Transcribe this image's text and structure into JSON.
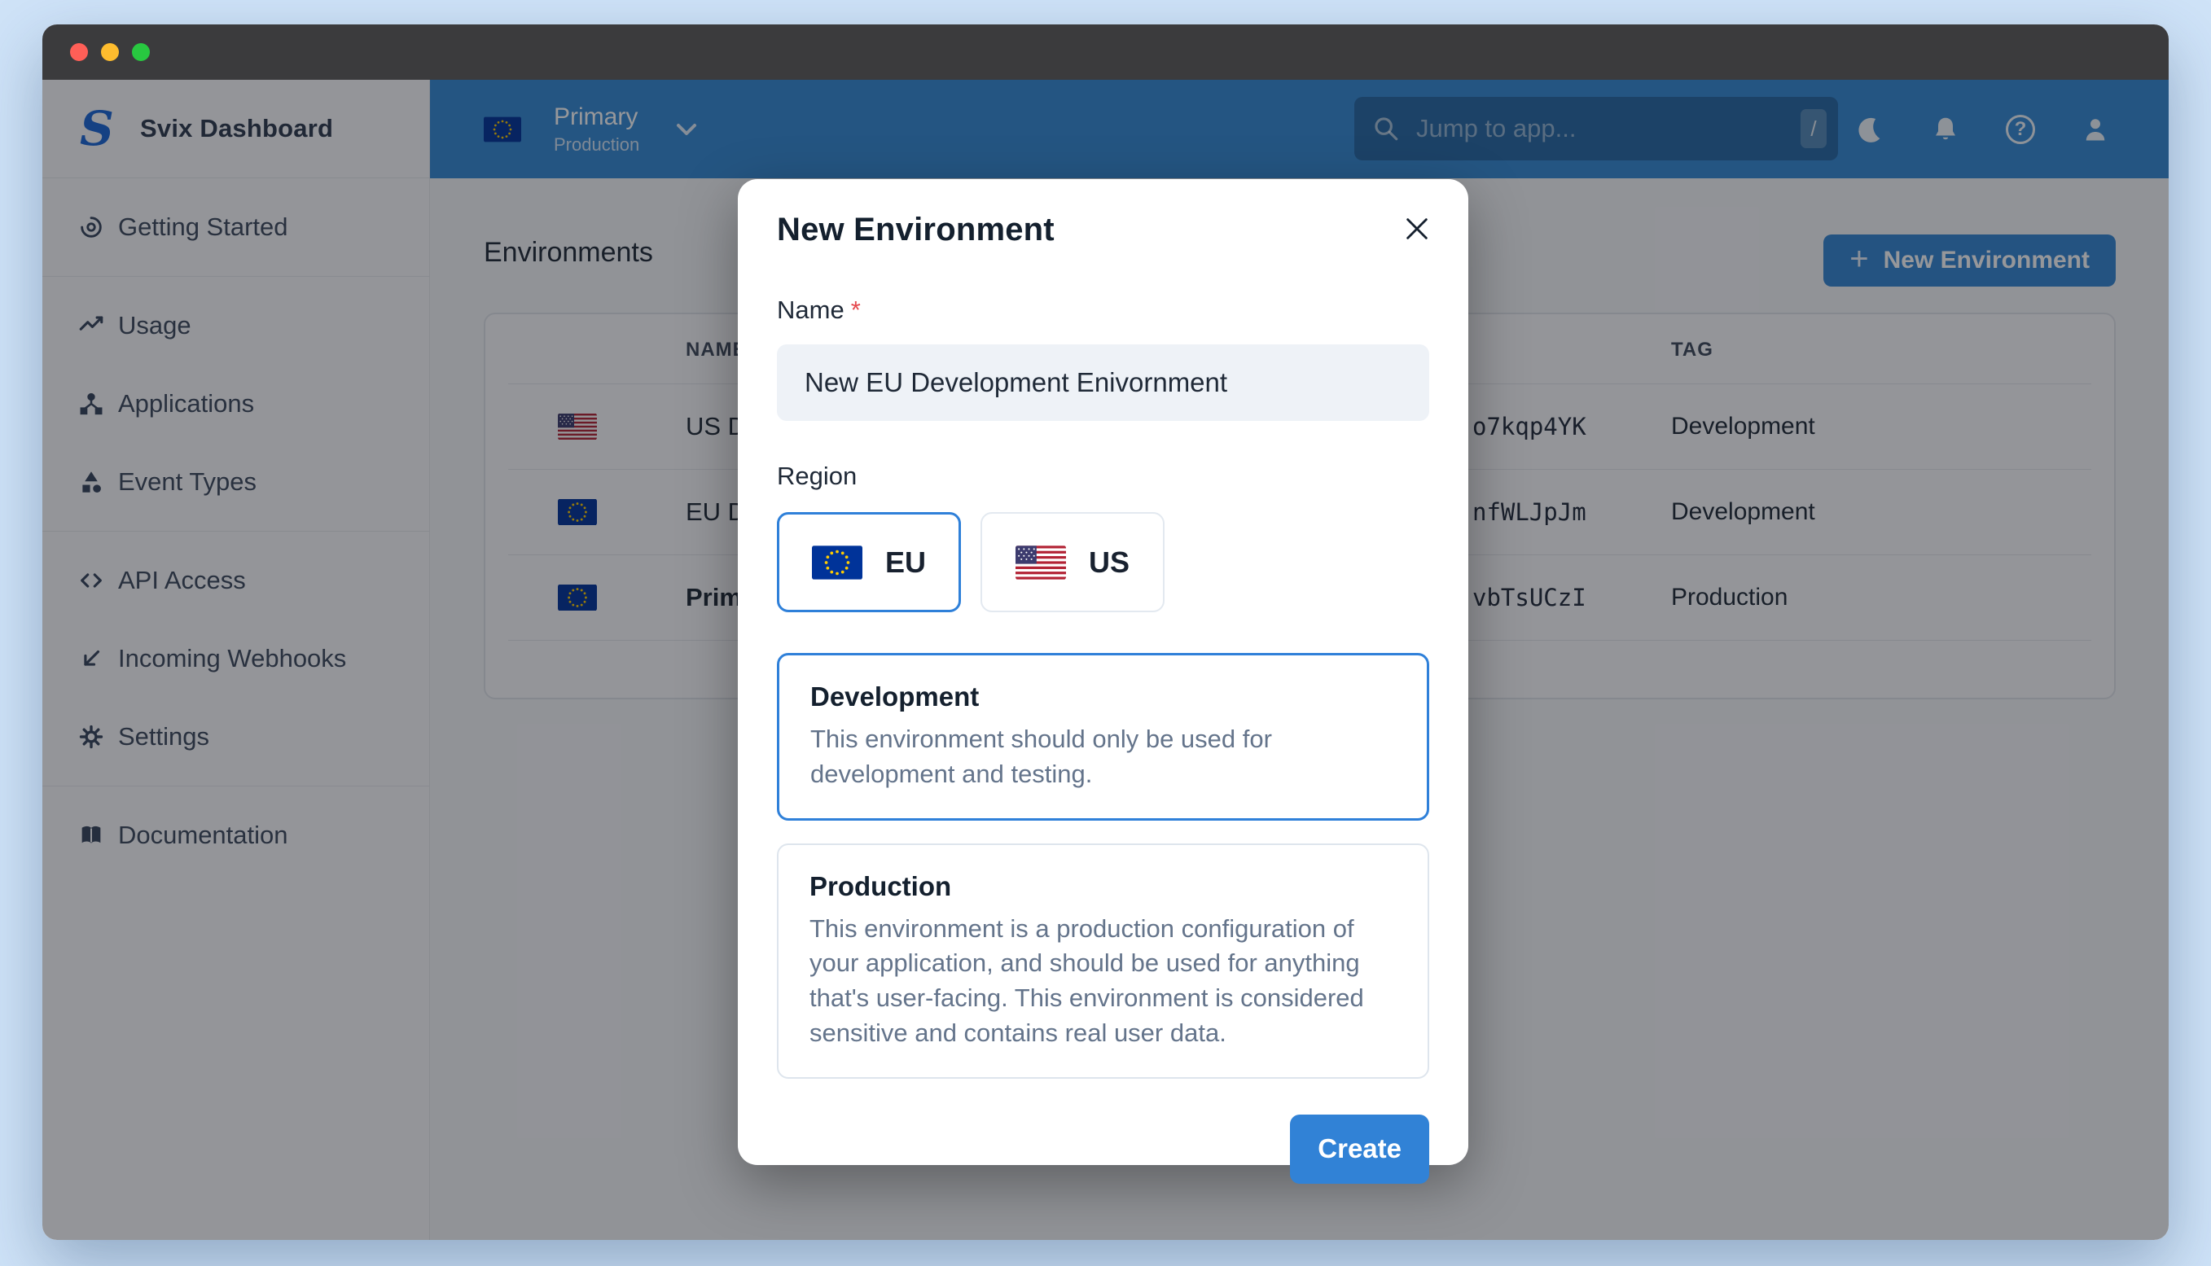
{
  "colors": {
    "brand_blue": "#3489D5",
    "button_blue": "#3182D6",
    "selected_border": "#2F80D9",
    "page_bg": "#CFE3F8",
    "titlebar_bg": "#3B3B3D",
    "overlay": "rgba(16,19,26,0.44)",
    "required_red": "#E5484D",
    "traffic_red": "#FF5F57",
    "traffic_yellow": "#FEBC2E",
    "traffic_green": "#28C840",
    "eu_flag_blue": "#003399",
    "eu_flag_gold": "#FFCC00",
    "us_flag_red": "#B22234",
    "us_flag_navy": "#3C3B6E"
  },
  "sidebar": {
    "brand": "Svix Dashboard",
    "logo_letter": "S",
    "sections": [
      {
        "items": [
          {
            "label": "Getting Started",
            "icon": "target-icon"
          }
        ]
      },
      {
        "items": [
          {
            "label": "Usage",
            "icon": "trend-line-icon"
          },
          {
            "label": "Applications",
            "icon": "nodes-icon"
          },
          {
            "label": "Event Types",
            "icon": "shapes-icon"
          }
        ]
      },
      {
        "items": [
          {
            "label": "API Access",
            "icon": "code-brackets-icon"
          },
          {
            "label": "Incoming Webhooks",
            "icon": "arrow-down-left-icon"
          },
          {
            "label": "Settings",
            "icon": "gear-icon"
          }
        ]
      },
      {
        "items": [
          {
            "label": "Documentation",
            "icon": "book-icon"
          }
        ]
      }
    ]
  },
  "topbar": {
    "environment_switcher": {
      "name": "Primary",
      "tag": "Production",
      "flag": "eu"
    },
    "search": {
      "placeholder": "Jump to app...",
      "shortcut_key": "/"
    },
    "icons": [
      "moon-icon",
      "bell-icon",
      "help-icon",
      "user-icon"
    ]
  },
  "main": {
    "heading": "Environments",
    "new_environment_button": {
      "label": "New Environment",
      "icon": "plus-icon",
      "plus": "+"
    },
    "table": {
      "visible_columns": {
        "name": "NAME",
        "tag": "TAG"
      },
      "rows": [
        {
          "flag": "us",
          "name_visible": "US D",
          "id_visible": "o7kqp4YK",
          "tag": "Development",
          "bold": false
        },
        {
          "flag": "eu",
          "name_visible": "EU D",
          "id_visible": "nfWLJpJm",
          "tag": "Development",
          "bold": false
        },
        {
          "flag": "eu",
          "name_visible": "Prim",
          "id_visible": "vbTsUCzI",
          "tag": "Production",
          "bold": true
        }
      ]
    }
  },
  "modal": {
    "title": "New Environment",
    "name_label": "Name",
    "required_mark": "*",
    "name_value": "New EU Development Enivornment",
    "region_label": "Region",
    "regions": [
      {
        "code": "EU",
        "flag": "eu",
        "selected": true
      },
      {
        "code": "US",
        "flag": "us",
        "selected": false
      }
    ],
    "environment_types": [
      {
        "title": "Development",
        "description": "This environment should only be used for development and testing.",
        "selected": true
      },
      {
        "title": "Production",
        "description": "This environment is a production configuration of your application, and should be used for anything that's user-facing. This environment is considered sensitive and contains real user data.",
        "selected": false
      }
    ],
    "create_button": "Create"
  }
}
